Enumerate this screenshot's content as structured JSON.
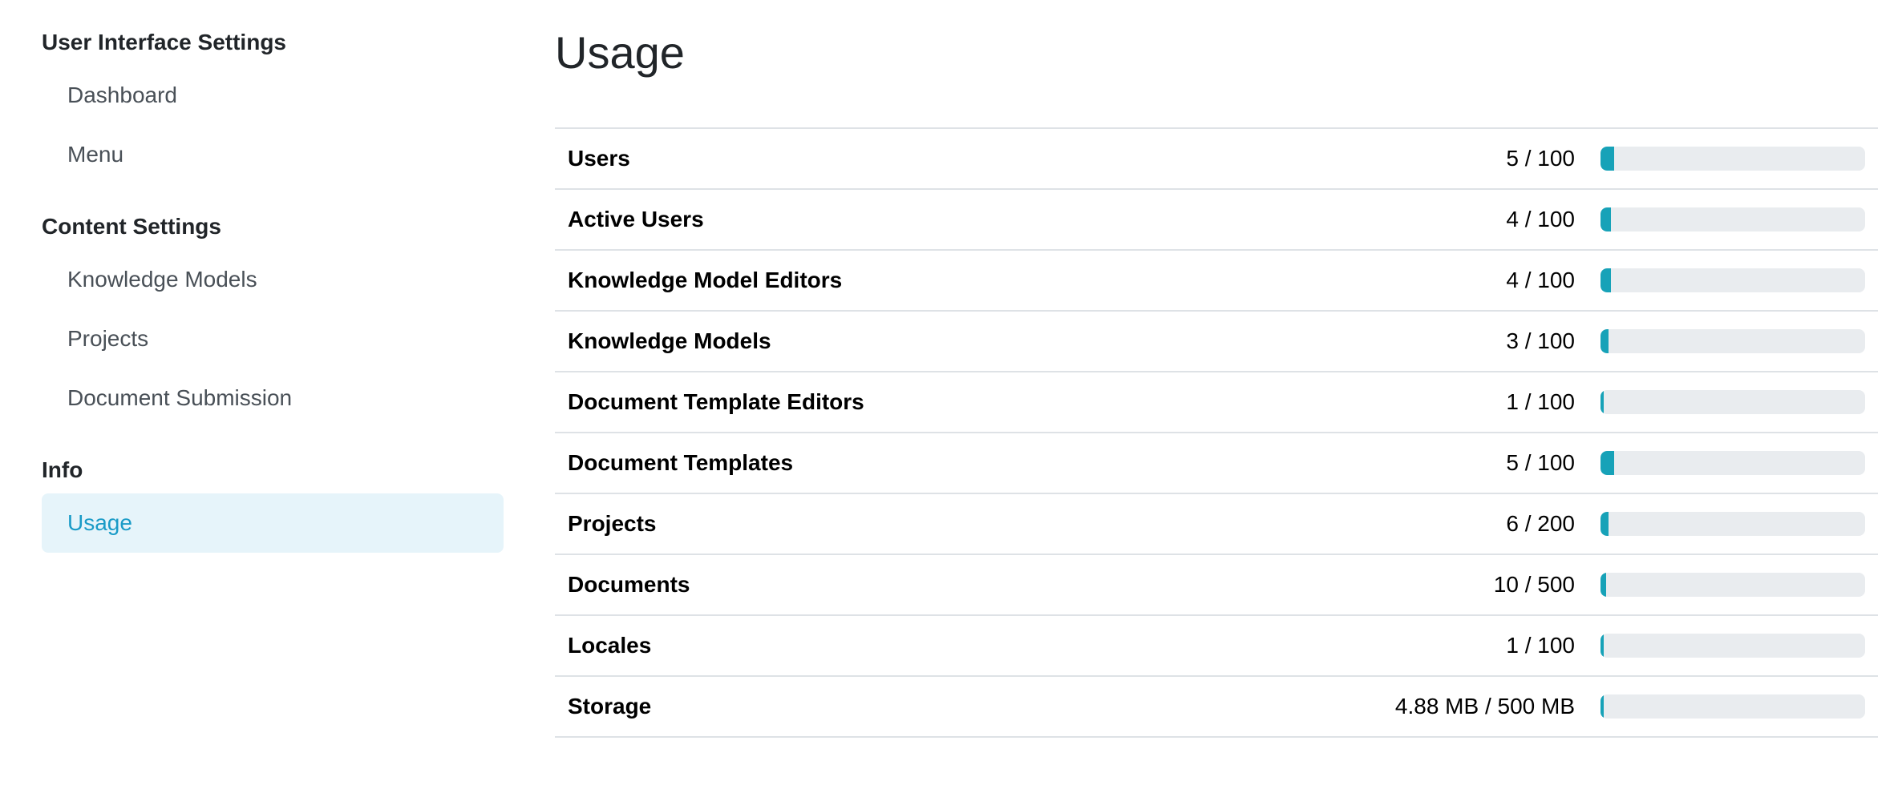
{
  "sidebar": {
    "sections": [
      {
        "heading": "User Interface Settings",
        "items": [
          {
            "label": "Dashboard"
          },
          {
            "label": "Menu"
          }
        ]
      },
      {
        "heading": "Content Settings",
        "items": [
          {
            "label": "Knowledge Models"
          },
          {
            "label": "Projects"
          },
          {
            "label": "Document Submission"
          }
        ]
      },
      {
        "heading": "Info",
        "items": [
          {
            "label": "Usage",
            "active": true
          }
        ]
      }
    ]
  },
  "main": {
    "title": "Usage",
    "rows": [
      {
        "label": "Users",
        "value": "5 / 100",
        "fraction": 0.05
      },
      {
        "label": "Active Users",
        "value": "4 / 100",
        "fraction": 0.04
      },
      {
        "label": "Knowledge Model Editors",
        "value": "4 / 100",
        "fraction": 0.04
      },
      {
        "label": "Knowledge Models",
        "value": "3 / 100",
        "fraction": 0.03
      },
      {
        "label": "Document Template Editors",
        "value": "1 / 100",
        "fraction": 0.01
      },
      {
        "label": "Document Templates",
        "value": "5 / 100",
        "fraction": 0.05
      },
      {
        "label": "Projects",
        "value": "6 / 200",
        "fraction": 0.03
      },
      {
        "label": "Documents",
        "value": "10 / 500",
        "fraction": 0.02
      },
      {
        "label": "Locales",
        "value": "1 / 100",
        "fraction": 0.01
      },
      {
        "label": "Storage",
        "value": "4.88 MB / 500 MB",
        "fraction": 0.0098
      }
    ]
  },
  "colors": {
    "accent": "#17a2b8",
    "active_bg": "#e6f4fa",
    "active_text": "#1a9bc7",
    "track": "#e9ecef"
  }
}
